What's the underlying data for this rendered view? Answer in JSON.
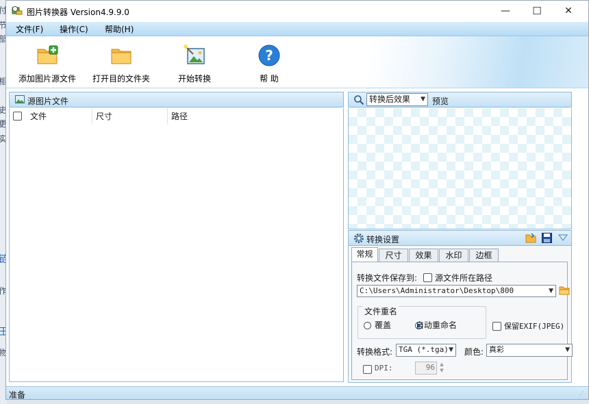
{
  "window": {
    "title": "图片转换器 Version4.9.9.0",
    "controls": {
      "minimize": "—",
      "maximize": "☐",
      "close": "✕"
    }
  },
  "desktop_fragments": [
    "付",
    "节",
    "部",
    "相",
    "史",
    "更",
    "实",
    "链",
    "作",
    "王",
    "物"
  ],
  "menu": {
    "items": [
      "文件(F)",
      "操作(C)",
      "帮助(H)"
    ]
  },
  "toolbar": {
    "add_source": "添加图片源文件",
    "open_dest": "打开目的文件夹",
    "start": "开始转换",
    "help": "帮  助"
  },
  "source_panel": {
    "title": "源图片文件",
    "columns": [
      "文件",
      "尺寸",
      "路径"
    ]
  },
  "preview_panel": {
    "mode_selected": "转换后效果",
    "label": "预览"
  },
  "settings_panel": {
    "title": "转换设置",
    "tabs": [
      "常规",
      "尺寸",
      "效果",
      "水印",
      "边框"
    ],
    "active_tab": "常规",
    "save_to_label": "转换文件保存到:",
    "source_path_checkbox": "源文件所在路径",
    "save_path": "C:\\Users\\Administrator\\Desktop\\800",
    "rename_group": "文件重名",
    "rename_overwrite": "覆盖",
    "rename_auto": "自动重命名",
    "keep_exif": "保留EXIF(JPEG)",
    "format_label": "转换格式:",
    "format_value": "TGA (*.tga)",
    "color_label": "颜色:",
    "color_value": "真彩",
    "dpi_label": "DPI:",
    "dpi_value": "96"
  },
  "status": {
    "text": "准备"
  },
  "colors": {
    "accent": "#1e62b0",
    "menubar": "#c6e3f7",
    "panel_border": "#8fb8d8"
  }
}
